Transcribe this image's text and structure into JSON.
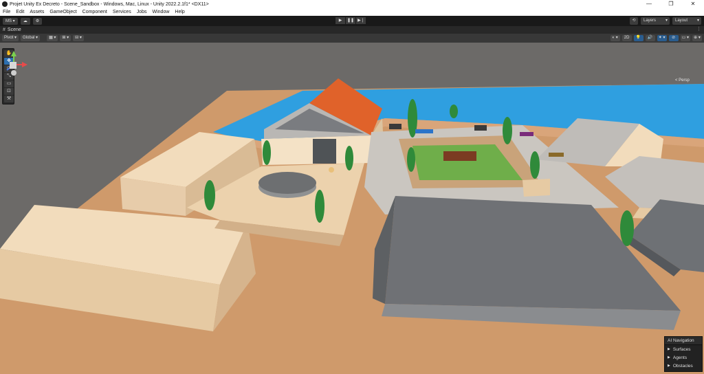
{
  "window": {
    "title": "Projet Unity Ex Decreto - Scene_Sandbox - Windows, Mac, Linux - Unity 2022.2.1f1* <DX11>",
    "controls": {
      "minimize": "—",
      "maximize": "❐",
      "close": "✕"
    }
  },
  "menu": [
    "File",
    "Edit",
    "Assets",
    "GameObject",
    "Component",
    "Services",
    "Jobs",
    "Window",
    "Help"
  ],
  "toolbar": {
    "account": "MS ▾",
    "cloud_icon": "cloud-icon",
    "collab_icon": "collab-icon",
    "play": "▶",
    "pause": "❚❚",
    "step": "▶❘",
    "history_icon": "⟲",
    "layers": "Layers",
    "layout": "Layout"
  },
  "scene_tab": {
    "icon": "#",
    "label": "Scene",
    "more": "⋮"
  },
  "scene_toolbar": {
    "pivot": "Pivot ▾",
    "global": "Global ▾",
    "grid_icon": "▦ ▾",
    "snap_icon": "⊞ ▾",
    "increment_icon": "⊟ ▾",
    "right": [
      "◐ ▾",
      "2D",
      "💡",
      "🔊",
      "✦ ▾",
      "⊘",
      "▭ ▾",
      "⊕ ▾"
    ]
  },
  "tools": [
    "✋",
    "✥",
    "⟳",
    "⤡",
    "▭",
    "⊡",
    "⚒"
  ],
  "gizmo": {
    "label": "< Persp"
  },
  "ai_navigation": {
    "title": "AI Navigation",
    "items": [
      "Surfaces",
      "Agents",
      "Obstacles"
    ]
  },
  "colors": {
    "sky": "#6c6a68",
    "water": "#2f9fe0",
    "ground": "#d09a6b",
    "block": "#efd6b3",
    "gray_block": "#6b6d70",
    "roof": "#e0622a",
    "plaza": "#c9c6c1",
    "tree": "#2f8a3a"
  }
}
